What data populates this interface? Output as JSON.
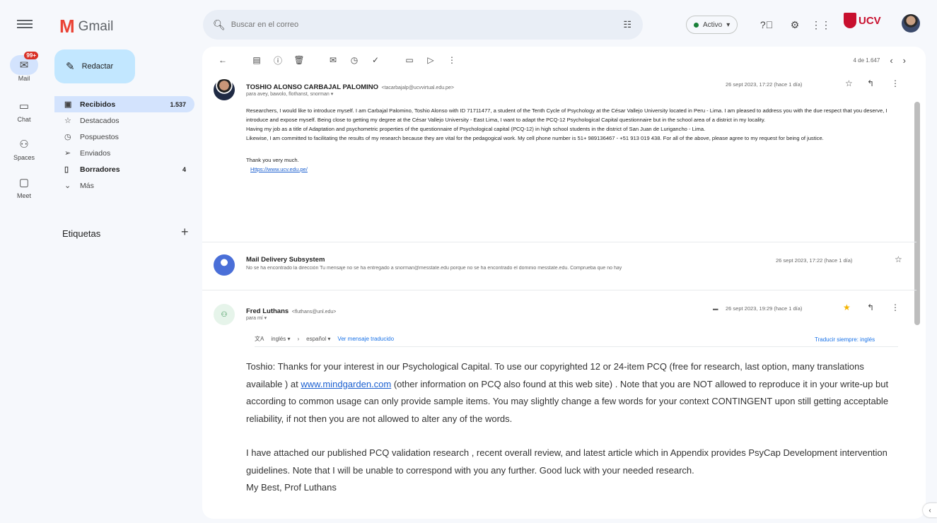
{
  "rail": {
    "items": [
      {
        "label": "Mail",
        "icon": "mail-icon",
        "badge": "99+",
        "glyph": "✉"
      },
      {
        "label": "Chat",
        "icon": "chat-icon",
        "glyph": "▭"
      },
      {
        "label": "Spaces",
        "icon": "spaces-icon",
        "glyph": "⚇"
      },
      {
        "label": "Meet",
        "icon": "meet-icon",
        "glyph": "▢"
      }
    ]
  },
  "app": {
    "logo_letter": "M",
    "name": "Gmail"
  },
  "compose": {
    "label": "Redactar"
  },
  "folders": [
    {
      "name": "Recibidos",
      "count": "1.537",
      "icon": "inbox-icon",
      "glyph": "▣"
    },
    {
      "name": "Destacados",
      "count": "",
      "icon": "star-icon",
      "glyph": "☆"
    },
    {
      "name": "Pospuestos",
      "count": "",
      "icon": "clock-icon",
      "glyph": "◷"
    },
    {
      "name": "Enviados",
      "count": "",
      "icon": "send-icon",
      "glyph": "➢"
    },
    {
      "name": "Borradores",
      "count": "4",
      "icon": "draft-icon",
      "glyph": "▯"
    },
    {
      "name": "Más",
      "count": "",
      "icon": "chevron-down-icon",
      "glyph": "⌄"
    }
  ],
  "labels": {
    "title": "Etiquetas",
    "add": "+"
  },
  "search": {
    "placeholder": "Buscar en el correo"
  },
  "status": {
    "label": "Activo"
  },
  "org": {
    "name": "UCV"
  },
  "toolbar": {
    "pager": "4 de 1.647"
  },
  "messages": [
    {
      "sender": "TOSHIO ALONSO CARBAJAL PALOMINO",
      "email": "<tacarbajalp@ucvvirtual.edu.pe>",
      "to": "para avey, bawolo, flothanst, snorman ▾",
      "date": "26 sept 2023, 17:22 (hace 1 día)",
      "paragraphs": [
        "Researchers, I would like to introduce myself. I am Carbajal Palomino, Toshio Alonso with ID 71711477, a student of the Tenth Cycle of Psychology at the César Vallejo University located in Peru - Lima. I am pleased to address you with the due respect that you deserve, I introduce and expose myself. Being close to getting my degree at the César Vallejo University - East Lima, I want to adapt the PCQ-12 Psychological Capital questionnaire but in the school area of a district in my locality.",
        "Having my job as a title of Adaptation and psychometric properties of the questionnaire of Psychological capital (PCQ-12) in high school students in the district of San Juan de Lurigancho - Lima.",
        "Likewise, I am committed to facilitating the results of my research because they are vital for the pedagogical work. My cell phone number is 51+ 989136467 - +51 913 019 438. For all of the above, please agree to my request for being of justice."
      ],
      "closing": "Thank you very much.",
      "link": "Https://www.ucv.edu.pe/"
    },
    {
      "sender": "Mail Delivery Subsystem",
      "date": "26 sept 2023, 17:22 (hace 1 día)",
      "snippet": "No se ha encontrado la dirección Tu mensaje no se ha entregado a snorman@messtate.edu porque no se ha encontrado el dominio messtate.edu. Comprueba que no hay"
    },
    {
      "sender": "Fred Luthans",
      "email": "<fluthans@unl.edu>",
      "to": "para mí ▾",
      "date": "26 sept 2023, 19:29 (hace 1 día)",
      "translate": {
        "from": "inglés ▾",
        "arrow": "›",
        "to": "español ▾",
        "view": "Ver mensaje traducido",
        "always": "Traducir siempre: inglés"
      },
      "p1_a": "Toshio: Thanks for your interest in our Psychological Capital. To  use our copyrighted  12 or 24-item PCQ  (free for research, last option, many translations available  ) at ",
      "p1_link": "www.mindgarden.com",
      "p1_b": " (other information on PCQ also found at this web site) . Note that you are NOT allowed to reproduce it  in your write-up but according to common usage can only provide sample items. You may slightly change a few words for your context CONTINGENT upon still getting acceptable reliability, if not then you are not allowed  to alter any of the words.",
      "p2": "I have attached our published PCQ validation research , recent overall review,  and latest article which in Appendix provides PsyCap Development intervention guidelines.   Note that I will be unable to correspond with you any further. Good luck with your needed research.",
      "p3": "My Best, Prof Luthans"
    }
  ]
}
